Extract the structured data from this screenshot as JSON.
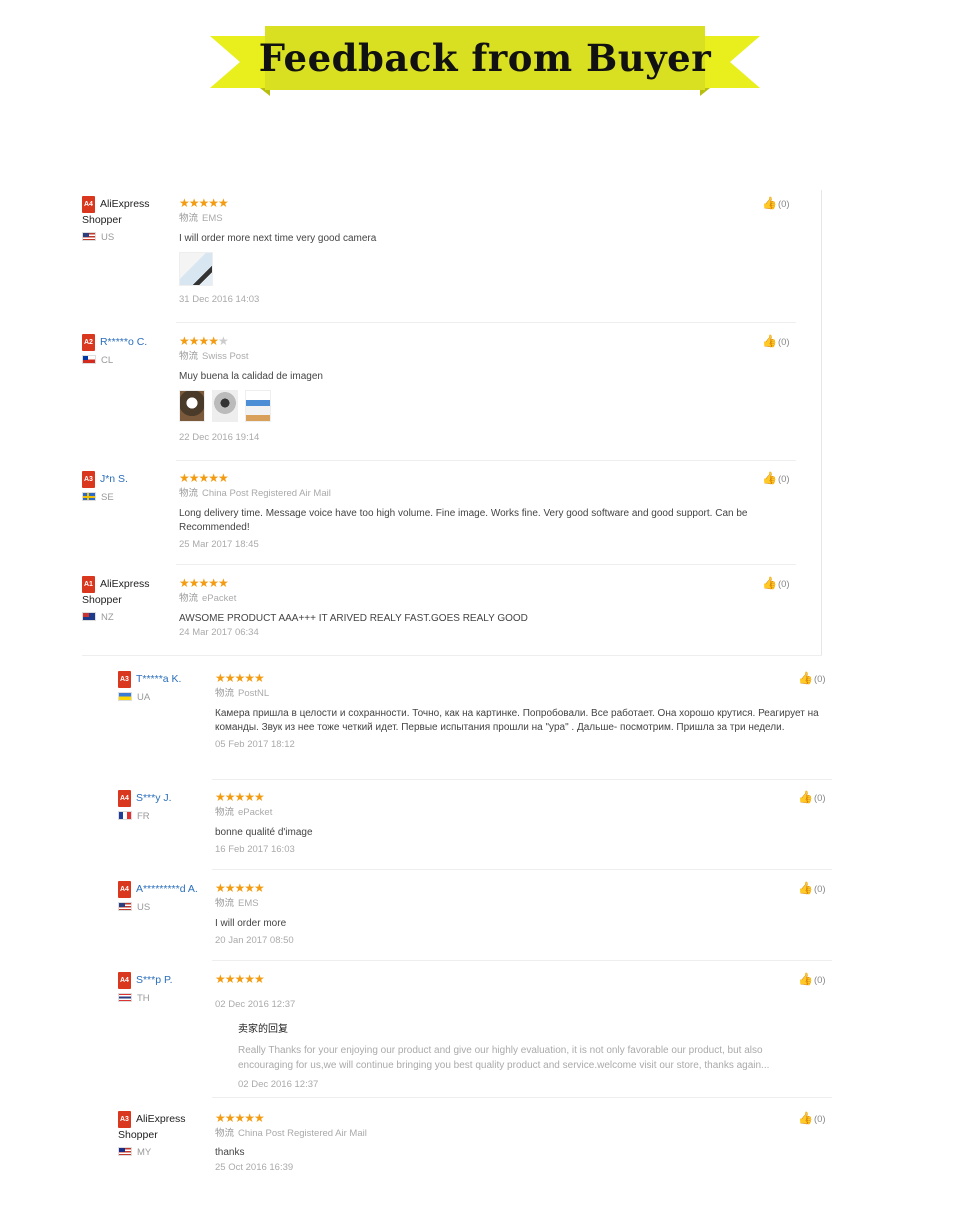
{
  "banner": {
    "title": "Feedback from Buyer"
  },
  "logistics_label": "物流",
  "reviews": [
    {
      "level": "A4",
      "buyer": "AliExpress Shopper",
      "country": "US",
      "stars": 5,
      "logistics": "EMS",
      "text": "I will order more next time very good camera",
      "date": "31 Dec 2016 14:03",
      "helpful": "(0)"
    },
    {
      "level": "A2",
      "buyer": "R*****o C.",
      "country": "CL",
      "stars": 4,
      "logistics": "Swiss Post",
      "text": "Muy buena la calidad de imagen",
      "date": "22 Dec 2016 19:14",
      "helpful": "(0)"
    },
    {
      "level": "A3",
      "buyer": "J*n S.",
      "country": "SE",
      "stars": 5,
      "logistics": "China Post Registered Air Mail",
      "text": "Long delivery time. Message voice have too high volume. Fine image. Works fine. Very good software and good support. Can be Recommended!",
      "date": "25 Mar 2017 18:45",
      "helpful": "(0)"
    },
    {
      "level": "A1",
      "buyer": "AliExpress Shopper",
      "country": "NZ",
      "stars": 5,
      "logistics": "ePacket",
      "text": "AWSOME PRODUCT AAA+++ IT ARIVED REALY FAST.GOES REALY GOOD",
      "date": "24 Mar 2017 06:34",
      "helpful": "(0)"
    },
    {
      "level": "A3",
      "buyer": "T*****a K.",
      "country": "UA",
      "stars": 5,
      "logistics": "PostNL",
      "text": "Камера пришла в целости и сохранности. Точно, как на картинке. Попробовали. Все работает. Она хорошо крутися. Реагирует на команды. Звук из нее тоже четкий идет. Первые испытания прошли на \"ура\" . Дальше- посмотрим. Пришла за три недели.",
      "date": "05 Feb 2017 18:12",
      "helpful": "(0)"
    },
    {
      "level": "A4",
      "buyer": "S***y J.",
      "country": "FR",
      "stars": 5,
      "logistics": "ePacket",
      "text": "bonne qualité d'image",
      "date": "16 Feb 2017 16:03",
      "helpful": "(0)"
    },
    {
      "level": "A4",
      "buyer": "A*********d A.",
      "country": "US",
      "stars": 5,
      "logistics": "EMS",
      "text": "I will order more",
      "date": "20 Jan 2017 08:50",
      "helpful": "(0)"
    },
    {
      "level": "A4",
      "buyer": "S***p P.",
      "country": "TH",
      "stars": 5,
      "date": "02 Dec 2016 12:37",
      "helpful": "(0)",
      "reply_title": "卖家的回复",
      "reply_text": "Really Thanks for your enjoying our product and give our highly evaluation, it is not only favorable our product, but also encouraging for us,we will continue bringing you best quality product and service.welcome visit our store, thanks again...",
      "reply_date": "02 Dec 2016 12:37"
    },
    {
      "level": "A3",
      "buyer": "AliExpress Shopper",
      "country": "MY",
      "stars": 5,
      "logistics": "China Post Registered Air Mail",
      "text": "thanks",
      "date": "25 Oct 2016 16:39",
      "helpful": "(0)"
    }
  ],
  "colors": {
    "banner_bg": "#d9e021",
    "banner_ribbon": "#e8ef1c",
    "star": "#f39c12",
    "badge": "#d9381e",
    "link": "#2a6ebb"
  },
  "icons": {
    "helpful": "thumbs-up-icon",
    "star": "star-icon"
  }
}
